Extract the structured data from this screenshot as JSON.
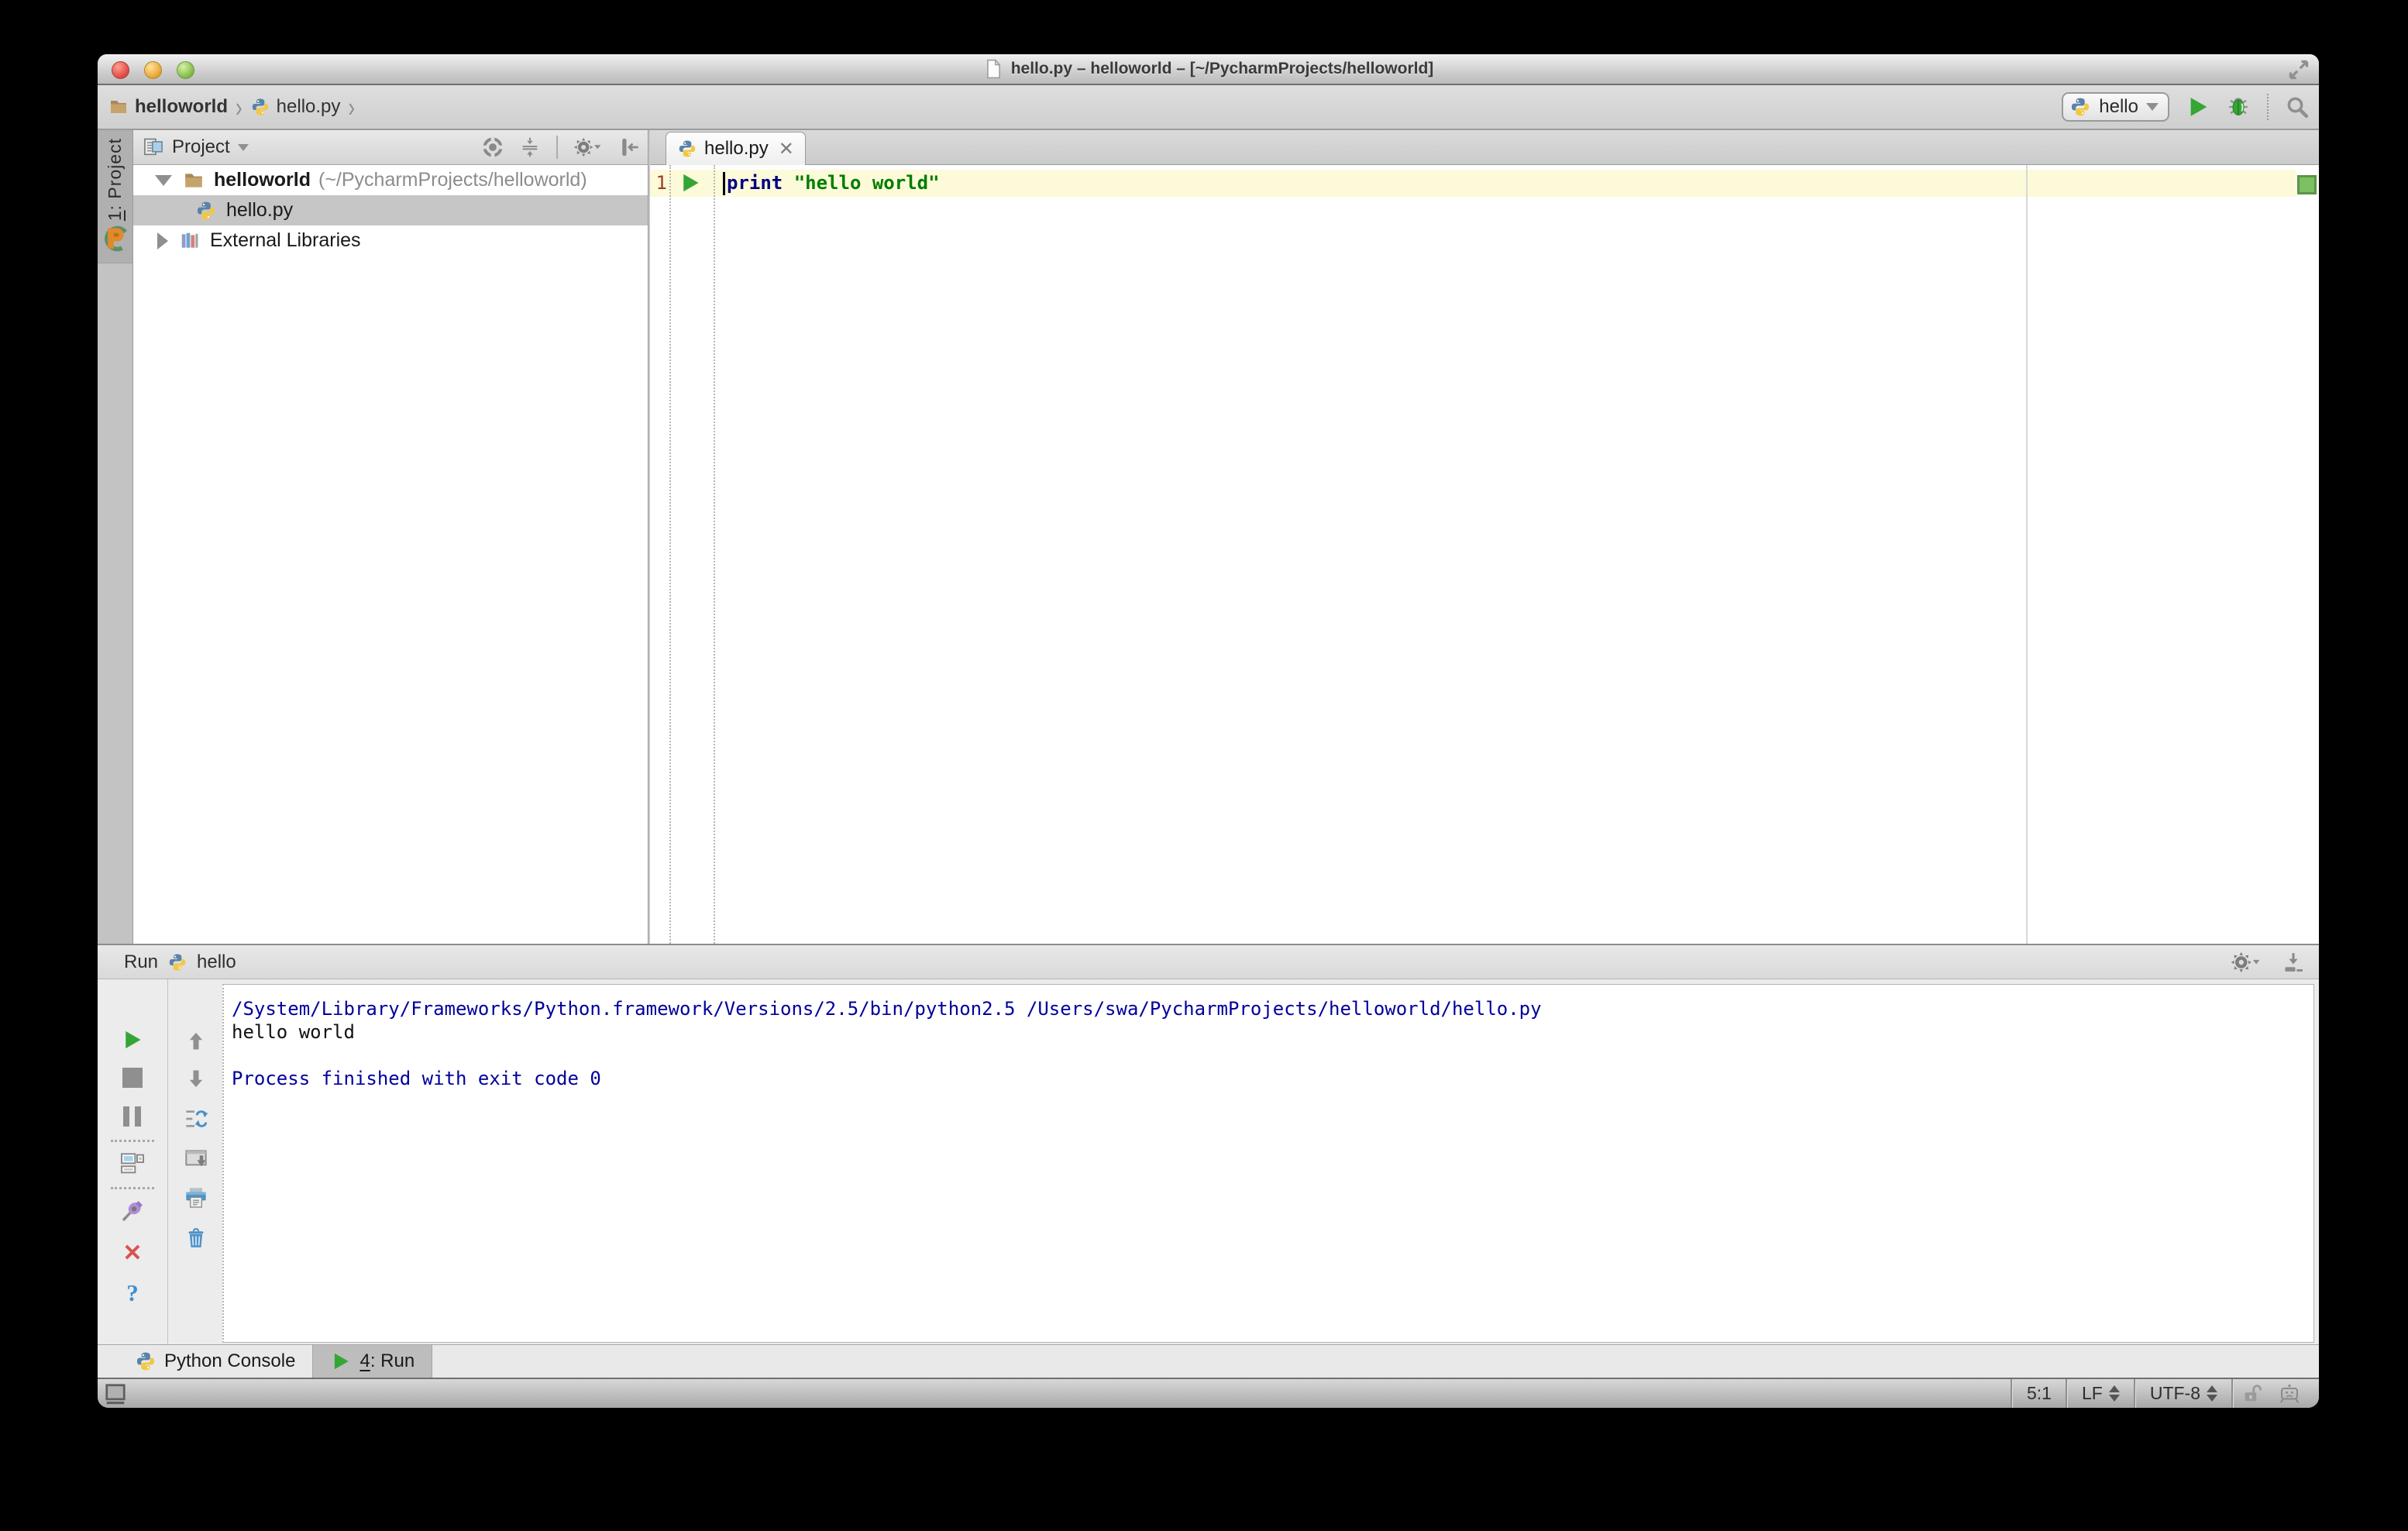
{
  "window": {
    "title": "hello.py – helloworld – [~/PycharmProjects/helloworld]"
  },
  "toolbar": {
    "breadcrumb_project": "helloworld",
    "breadcrumb_file": "hello.py",
    "crumb_sep": "›",
    "run_config": "hello"
  },
  "tool_stripe": {
    "project_tab_num": "1",
    "project_tab_rest": ": Project"
  },
  "project_panel": {
    "header_title": "Project",
    "root_name": "helloworld",
    "root_path": "(~/PycharmProjects/helloworld)",
    "file_name": "hello.py",
    "external_libraries": "External Libraries"
  },
  "editor": {
    "tab_label": "hello.py",
    "tab_close": "✕",
    "line_number": "1",
    "code": {
      "keyword": "print",
      "space": " ",
      "string": "\"hello world\""
    }
  },
  "run_panel": {
    "title": "Run",
    "config_name": "hello",
    "console_lines": {
      "line1": "/System/Library/Frameworks/Python.framework/Versions/2.5/bin/python2.5 /Users/swa/PycharmProjects/helloworld/hello.py",
      "line2": "hello world",
      "line3": "",
      "line4": "Process finished with exit code 0"
    }
  },
  "bottom_bar": {
    "python_console_label": "Python Console",
    "run_tab_num": "4",
    "run_tab_rest": ": Run"
  },
  "status_bar": {
    "caret_position": "5:1",
    "line_ending": "LF",
    "encoding": "UTF-8"
  },
  "colors": {
    "keyword": "#000080",
    "string": "#007d00",
    "console_system": "#00009c",
    "current_line_highlight": "#fcfad8",
    "run_green": "#35a535",
    "inspection_ok_square": "#7cc161",
    "selected_row": "#c6c6c6"
  },
  "icons": {
    "document-icon": "white page with folded corner",
    "fullscreen-resize-icon": "two diagonal outward arrows",
    "folder-icon": "tan folder",
    "python-icon": "blue/yellow python logo",
    "play-icon": "green triangle",
    "debug-bug-icon": "green bug",
    "search-icon": "magnifier",
    "project-pane-icon": "panel with list",
    "locate-target-icon": "circle crosshair",
    "collapse-all-icon": "arrows toward double line",
    "gear-icon": "cogwheel + dropdown",
    "hide-panel-icon": "bar with left arrow",
    "library-icon": "colored book spines",
    "stop-icon": "gray square",
    "pause-icon": "two gray bars",
    "show-console-icon": "window layout",
    "pin-icon": "purple pushpin",
    "close-icon": "red cross",
    "help-icon": "blue question mark",
    "up-arrow-icon": "gray up arrow",
    "down-arrow-icon": "gray down arrow",
    "restore-layout-icon": "blue cyclic arrows over lines",
    "dock-icon": "window with down arrow",
    "print-icon": "blue printer",
    "trash-icon": "blue garbage can",
    "hide-down-icon": "down arrow onto bar",
    "toggle-toolbuttons-icon": "framed square",
    "unlock-icon": "open padlock",
    "hector-inspector-icon": "robot face"
  }
}
